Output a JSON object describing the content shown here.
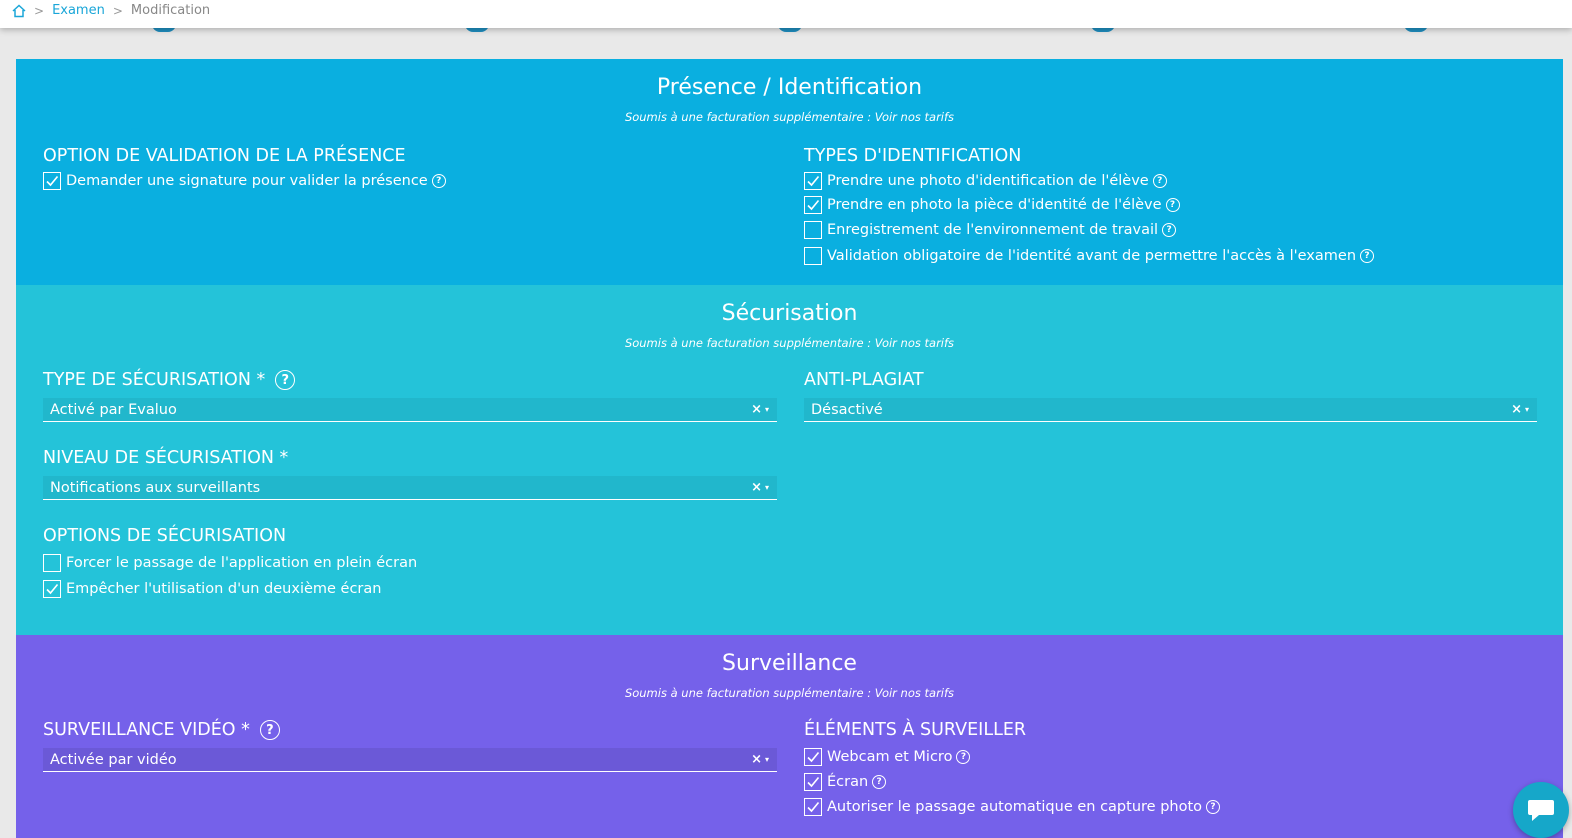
{
  "breadcrumb": {
    "home_icon": "home-icon",
    "items": [
      "Examen",
      "Modification"
    ]
  },
  "colors": {
    "presence_bg": "#0aafe0",
    "secure_bg": "#24c3d9",
    "surveillance_bg": "#7561ea",
    "link": "#1aa6d8",
    "chat": "#16a7c9"
  },
  "presence": {
    "title": "Présence / Identification",
    "note": "Soumis à une facturation supplémentaire : Voir nos tarifs",
    "validation": {
      "title": "OPTION DE VALIDATION DE LA PRÉSENCE",
      "options": [
        {
          "label": "Demander une signature pour valider la présence",
          "checked": true
        }
      ]
    },
    "identification": {
      "title": "TYPES D'IDENTIFICATION",
      "options": [
        {
          "label": "Prendre une photo d'identification de l'élève",
          "checked": true
        },
        {
          "label": "Prendre en photo la pièce d'identité de l'élève",
          "checked": true
        },
        {
          "label": "Enregistrement de l'environnement de travail",
          "checked": false
        },
        {
          "label": "Validation obligatoire de l'identité avant de permettre l'accès à l'examen",
          "checked": false
        }
      ]
    }
  },
  "securisation": {
    "title": "Sécurisation",
    "note": "Soumis à une facturation supplémentaire : Voir nos tarifs",
    "type": {
      "label": "TYPE DE SÉCURISATION *",
      "value": "Activé par Evaluo"
    },
    "anti_plagiat": {
      "label": "ANTI-PLAGIAT",
      "value": "Désactivé"
    },
    "niveau": {
      "label": "NIVEAU DE SÉCURISATION *",
      "value": "Notifications aux surveillants"
    },
    "options": {
      "title": "OPTIONS DE SÉCURISATION",
      "items": [
        {
          "label": "Forcer le passage de l'application en plein écran",
          "checked": false
        },
        {
          "label": "Empêcher l'utilisation d'un deuxième écran",
          "checked": true
        }
      ]
    }
  },
  "surveillance": {
    "title": "Surveillance",
    "note": "Soumis à une facturation supplémentaire : Voir nos tarifs",
    "video": {
      "label": "SURVEILLANCE VIDÉO *",
      "value": "Activée par vidéo"
    },
    "elements": {
      "title": "ÉLÉMENTS À SURVEILLER",
      "items": [
        {
          "label": "Webcam et Micro",
          "checked": true
        },
        {
          "label": "Écran",
          "checked": true
        },
        {
          "label": "Autoriser le passage automatique en capture photo",
          "checked": true
        }
      ]
    }
  },
  "select_controls": {
    "clear": "×",
    "caret": "▾"
  },
  "help_glyph": "?"
}
